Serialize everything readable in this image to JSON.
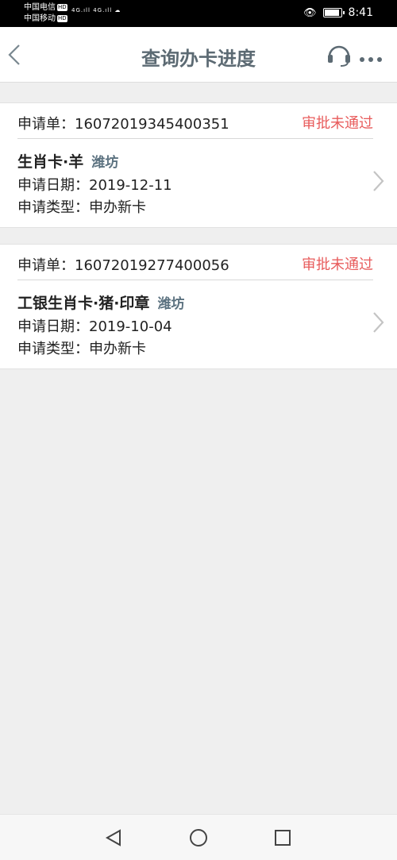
{
  "status_bar": {
    "carrier1": "中国电信",
    "carrier2": "中国移动",
    "hd": "HD",
    "net1": "4G",
    "net2": "4G",
    "time": "8:41"
  },
  "nav": {
    "title": "查询办卡进度"
  },
  "labels": {
    "app_no": "申请单：",
    "date": "申请日期：",
    "type": "申请类型："
  },
  "applications": [
    {
      "number": "16072019345400351",
      "status": "审批未通过",
      "card_name": "生肖卡·羊",
      "city": "潍坊",
      "date": "2019-12-11",
      "type": "申办新卡"
    },
    {
      "number": "16072019277400056",
      "status": "审批未通过",
      "card_name": "工银生肖卡·猪·印章",
      "city": "潍坊",
      "date": "2019-10-04",
      "type": "申办新卡"
    }
  ],
  "colors": {
    "status_rejected": "#e85c5c",
    "title": "#5c6a73",
    "city": "#5c7280"
  }
}
